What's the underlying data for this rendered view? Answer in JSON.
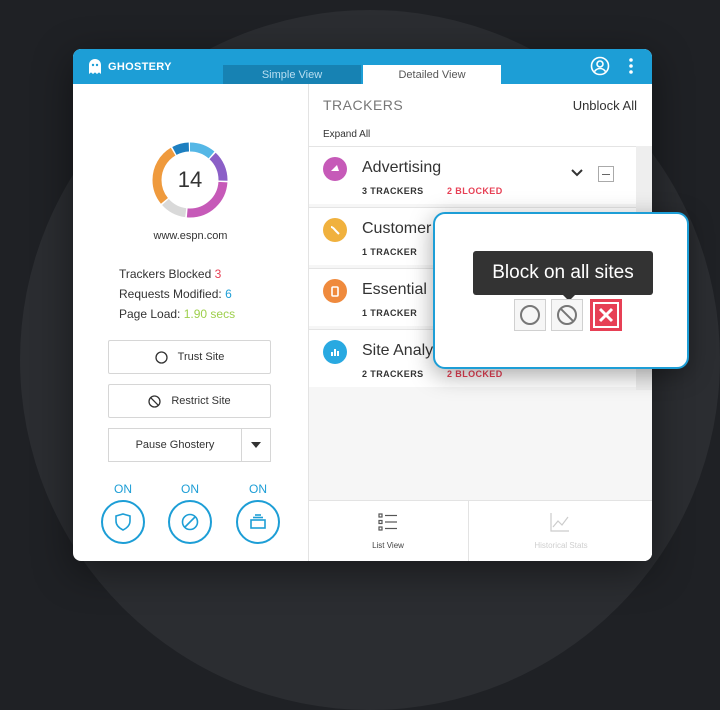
{
  "header": {
    "brand": "GHOSTERY",
    "tabs": [
      {
        "label": "Simple View",
        "active": false
      },
      {
        "label": "Detailed View",
        "active": true
      }
    ],
    "icons": [
      "account-icon",
      "kebab-menu-icon"
    ]
  },
  "summary": {
    "tracker_count": "14",
    "domain": "www.espn.com",
    "stats": [
      {
        "label": "Trackers Blocked",
        "value": "3"
      },
      {
        "label": "Requests Modified:",
        "value": "6"
      },
      {
        "label": "Page Load:",
        "value": "1.90 secs"
      }
    ],
    "donut_segments": [
      {
        "color": "#55b7e6",
        "fraction": 0.12
      },
      {
        "color": "#8b5fc7",
        "fraction": 0.14
      },
      {
        "color": "#c65ab8",
        "fraction": 0.26
      },
      {
        "color": "#d9d9d9",
        "fraction": 0.12
      },
      {
        "color": "#ef9a3d",
        "fraction": 0.28
      },
      {
        "color": "#1d7fc0",
        "fraction": 0.08
      }
    ]
  },
  "actions": {
    "trust_label": "Trust Site",
    "restrict_label": "Restrict Site",
    "pause_label": "Pause Ghostery"
  },
  "toggles": [
    {
      "state": "ON",
      "icon": "shield-icon"
    },
    {
      "state": "ON",
      "icon": "block-ads-icon"
    },
    {
      "state": "ON",
      "icon": "smart-blocking-icon"
    }
  ],
  "trackers": {
    "title": "TRACKERS",
    "unblock_all": "Unblock All",
    "expand_all": "Expand All",
    "categories": [
      {
        "name": "Advertising",
        "count": "3 TRACKERS",
        "blocked": "2 BLOCKED",
        "color": "#c65ab8"
      },
      {
        "name": "Customer Interaction",
        "count": "1 TRACKER",
        "blocked": "",
        "color": "#f0b13e"
      },
      {
        "name": "Essential",
        "count": "1 TRACKER",
        "blocked": "",
        "color": "#ef8a3d"
      },
      {
        "name": "Site Analytics",
        "count": "2 TRACKERS",
        "blocked": "2 BLOCKED",
        "color": "#29a9e1"
      }
    ]
  },
  "popup": {
    "tooltip": "Block on all sites",
    "buttons": [
      "allow-icon",
      "restrict-icon",
      "block-icon"
    ]
  },
  "bottom_tabs": [
    {
      "label": "List View",
      "active": true
    },
    {
      "label": "Historical Stats",
      "active": false
    }
  ],
  "colors": {
    "brand_blue": "#1d9ed6",
    "blocked_red": "#e74055",
    "load_green": "#9ecf4c"
  }
}
